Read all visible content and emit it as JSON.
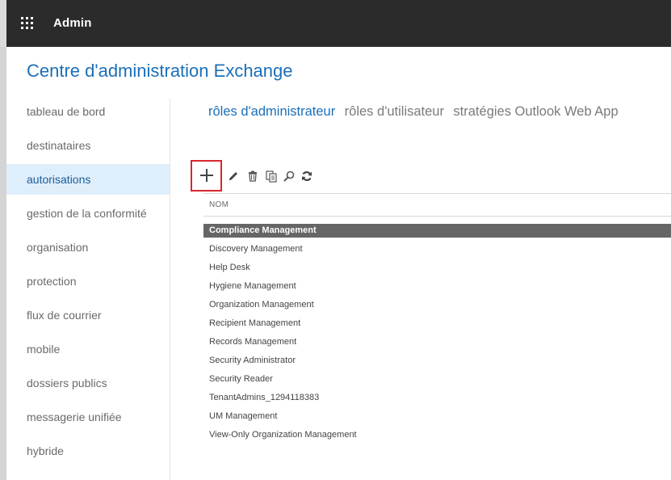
{
  "header": {
    "app_name": "Admin"
  },
  "page": {
    "title": "Centre d'administration Exchange"
  },
  "sidebar": {
    "selected_index": 2,
    "items": [
      {
        "label": "tableau de bord"
      },
      {
        "label": "destinataires"
      },
      {
        "label": "autorisations"
      },
      {
        "label": "gestion de la conformité"
      },
      {
        "label": "organisation"
      },
      {
        "label": "protection"
      },
      {
        "label": "flux de courrier"
      },
      {
        "label": "mobile"
      },
      {
        "label": "dossiers publics"
      },
      {
        "label": "messagerie unifiée"
      },
      {
        "label": "hybride"
      }
    ]
  },
  "tabs": [
    {
      "label": "rôles d'administrateur",
      "active": true
    },
    {
      "label": "rôles d'utilisateur",
      "active": false
    },
    {
      "label": "stratégies Outlook Web App",
      "active": false
    }
  ],
  "toolbar": {
    "icons": [
      "add-icon",
      "edit-icon",
      "delete-icon",
      "copy-icon",
      "search-icon",
      "refresh-icon"
    ],
    "highlight_color": "#d8272d"
  },
  "table": {
    "column_header": "NOM",
    "selected_index": 0,
    "rows": [
      "Compliance Management",
      "Discovery Management",
      "Help Desk",
      "Hygiene Management",
      "Organization Management",
      "Recipient Management",
      "Records Management",
      "Security Administrator",
      "Security Reader",
      "TenantAdmins_1294118383",
      "UM Management",
      "View-Only Organization Management"
    ]
  },
  "colors": {
    "accent": "#1b6fb8",
    "header_bg": "#2b2b2b",
    "selected_row_bg": "#666666",
    "selected_nav_bg": "#dfeefb"
  }
}
